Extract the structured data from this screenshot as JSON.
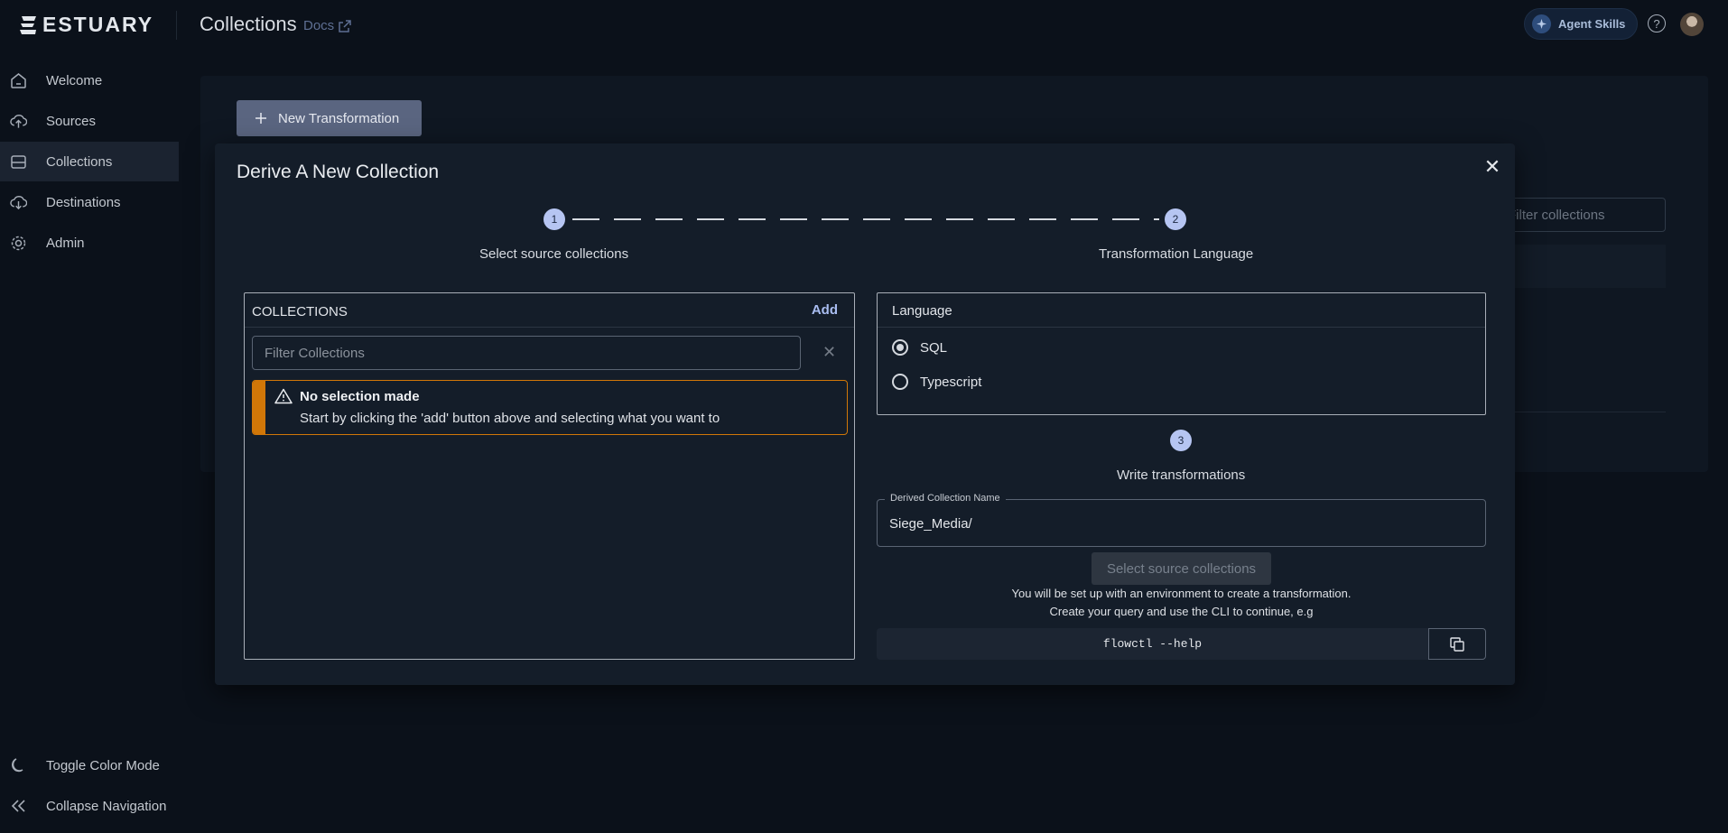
{
  "header": {
    "brand": "ESTUARY",
    "title": "Collections",
    "docs_label": "Docs",
    "agent_skills_label": "Agent Skills"
  },
  "sidebar": {
    "items": [
      {
        "label": "Welcome",
        "icon": "home-icon"
      },
      {
        "label": "Sources",
        "icon": "cloud-upload-icon"
      },
      {
        "label": "Collections",
        "icon": "database-icon",
        "active": true
      },
      {
        "label": "Destinations",
        "icon": "cloud-download-icon"
      },
      {
        "label": "Admin",
        "icon": "gear-icon"
      }
    ],
    "bottom": [
      {
        "label": "Toggle Color Mode",
        "icon": "moon-icon"
      },
      {
        "label": "Collapse Navigation",
        "icon": "double-chevron-left-icon"
      }
    ]
  },
  "background": {
    "new_transformation_label": "New Transformation",
    "filter_placeholder": "Filter collections"
  },
  "modal": {
    "title": "Derive A New Collection",
    "steps": [
      {
        "number": "1",
        "label": "Select source collections"
      },
      {
        "number": "2",
        "label": "Transformation Language"
      },
      {
        "number": "3",
        "label": "Write transformations"
      }
    ],
    "collections": {
      "header": "COLLECTIONS",
      "add_label": "Add",
      "filter_placeholder": "Filter Collections",
      "alert_title": "No selection made",
      "alert_message": "Start by clicking the 'add' button above and selecting what you want to"
    },
    "language": {
      "header": "Language",
      "options": [
        {
          "label": "SQL",
          "selected": true
        },
        {
          "label": "Typescript",
          "selected": false
        }
      ]
    },
    "derived_name": {
      "label": "Derived Collection Name",
      "value": "Siege_Media/"
    },
    "select_button_label": "Select source collections",
    "info_lines": [
      "You will be set up with an environment to create a transformation.",
      "Create your query and use the CLI to continue, e.g"
    ],
    "cli_command": "flowctl --help"
  },
  "colors": {
    "accent": "#b6c5f2",
    "warning": "#d17708",
    "background": "#0b111a",
    "modal": "#141d29"
  }
}
